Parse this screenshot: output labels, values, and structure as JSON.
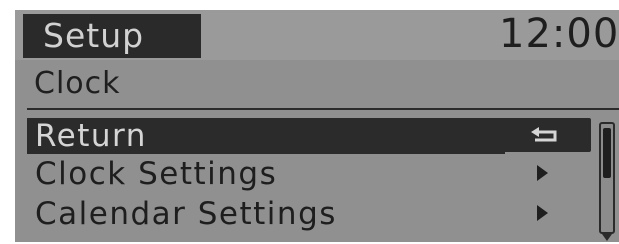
{
  "header": {
    "title": "Setup",
    "clock": "12:00"
  },
  "screen": {
    "subtitle": "Clock"
  },
  "menu": {
    "items": [
      {
        "label": "Return",
        "selected": true,
        "trailing_icon": "return-icon"
      },
      {
        "label": "Clock Settings",
        "selected": false,
        "trailing_icon": "chevron-right-icon"
      },
      {
        "label": "Calendar Settings",
        "selected": false,
        "trailing_icon": "chevron-right-icon"
      }
    ]
  },
  "colors": {
    "background": "#909090",
    "highlight": "#2b2b2b",
    "text_dark": "#1e1e1e",
    "text_light": "#d5d5d5"
  }
}
